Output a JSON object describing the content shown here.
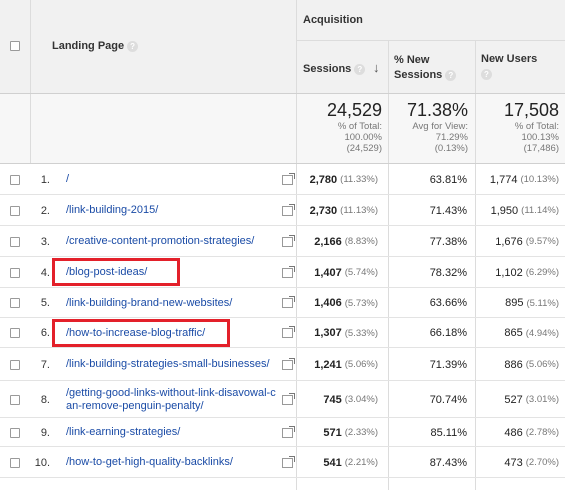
{
  "header": {
    "group_label": "Acquisition",
    "landing_page_label": "Landing Page",
    "sessions_label": "Sessions",
    "new_sessions_label": "% New Sessions",
    "new_users_label": "New Users",
    "help_glyph": "?",
    "sort_arrow": "↓"
  },
  "totals": {
    "sessions": "24,529",
    "sessions_note_1": "% of Total:",
    "sessions_note_2": "100.00%",
    "sessions_note_3": "(24,529)",
    "new_sessions": "71.38%",
    "new_sessions_note_1": "Avg for View:",
    "new_sessions_note_2": "71.29%",
    "new_sessions_note_3": "(0.13%)",
    "new_users": "17,508",
    "new_users_note_1": "% of Total:",
    "new_users_note_2": "100.13%",
    "new_users_note_3": "(17,486)"
  },
  "rows": [
    {
      "num": "1.",
      "page": "/",
      "sessions": "2,780",
      "sessions_pct": "(11.33%)",
      "new_sessions": "63.81%",
      "new_users": "1,774",
      "new_users_pct": "(10.13%)"
    },
    {
      "num": "2.",
      "page": "/link-building-2015/",
      "sessions": "2,730",
      "sessions_pct": "(11.13%)",
      "new_sessions": "71.43%",
      "new_users": "1,950",
      "new_users_pct": "(11.14%)"
    },
    {
      "num": "3.",
      "page": "/creative-content-promotion-strategies/",
      "sessions": "2,166",
      "sessions_pct": "(8.83%)",
      "new_sessions": "77.38%",
      "new_users": "1,676",
      "new_users_pct": "(9.57%)"
    },
    {
      "num": "4.",
      "page": "/blog-post-ideas/",
      "sessions": "1,407",
      "sessions_pct": "(5.74%)",
      "new_sessions": "78.32%",
      "new_users": "1,102",
      "new_users_pct": "(6.29%)"
    },
    {
      "num": "5.",
      "page": "/link-building-brand-new-websites/",
      "sessions": "1,406",
      "sessions_pct": "(5.73%)",
      "new_sessions": "63.66%",
      "new_users": "895",
      "new_users_pct": "(5.11%)"
    },
    {
      "num": "6.",
      "page": "/how-to-increase-blog-traffic/",
      "sessions": "1,307",
      "sessions_pct": "(5.33%)",
      "new_sessions": "66.18%",
      "new_users": "865",
      "new_users_pct": "(4.94%)"
    },
    {
      "num": "7.",
      "page": "/link-building-strategies-small-businesses/",
      "sessions": "1,241",
      "sessions_pct": "(5.06%)",
      "new_sessions": "71.39%",
      "new_users": "886",
      "new_users_pct": "(5.06%)"
    },
    {
      "num": "8.",
      "page": "/getting-good-links-without-link-disavowal-can-remove-penguin-penalty/",
      "sessions": "745",
      "sessions_pct": "(3.04%)",
      "new_sessions": "70.74%",
      "new_users": "527",
      "new_users_pct": "(3.01%)"
    },
    {
      "num": "9.",
      "page": "/link-earning-strategies/",
      "sessions": "571",
      "sessions_pct": "(2.33%)",
      "new_sessions": "85.11%",
      "new_users": "486",
      "new_users_pct": "(2.78%)"
    },
    {
      "num": "10.",
      "page": "/how-to-get-high-quality-backlinks/",
      "sessions": "541",
      "sessions_pct": "(2.21%)",
      "new_sessions": "87.43%",
      "new_users": "473",
      "new_users_pct": "(2.70%)"
    }
  ],
  "highlight_color": "#e3202a",
  "link_color": "#1a4ba6"
}
